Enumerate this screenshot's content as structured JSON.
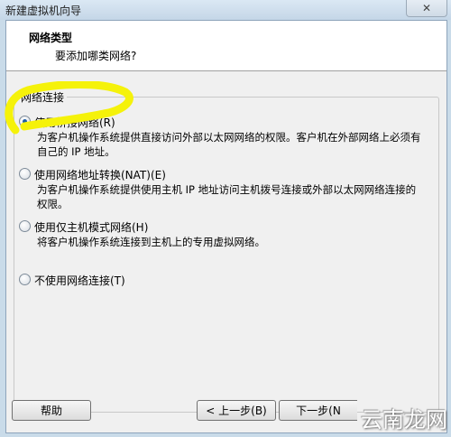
{
  "window": {
    "title": "新建虚拟机向导",
    "close_label": "✕"
  },
  "header": {
    "title": "网络类型",
    "subtitle": "要添加哪类网络?"
  },
  "group": {
    "title": "网络连接",
    "options": [
      {
        "label": "使用桥接网络(R)",
        "description": "为客户机操作系统提供直接访问外部以太网网络的权限。客户机在外部网络上必须有自己的 IP 地址。",
        "selected": true
      },
      {
        "label": "使用网络地址转换(NAT)(E)",
        "description": "为客户机操作系统提供使用主机 IP 地址访问主机拨号连接或外部以太网网络连接的权限。",
        "selected": false
      },
      {
        "label": "使用仅主机模式网络(H)",
        "description": "将客户机操作系统连接到主机上的专用虚拟网络。",
        "selected": false
      },
      {
        "label": "不使用网络连接(T)",
        "description": "",
        "selected": false
      }
    ]
  },
  "buttons": {
    "help": "帮助",
    "back": "< 上一步(B)",
    "next": "下一步(N"
  },
  "annotation": {
    "color": "#f5f20a"
  },
  "watermark": {
    "text": "云南龙网"
  }
}
